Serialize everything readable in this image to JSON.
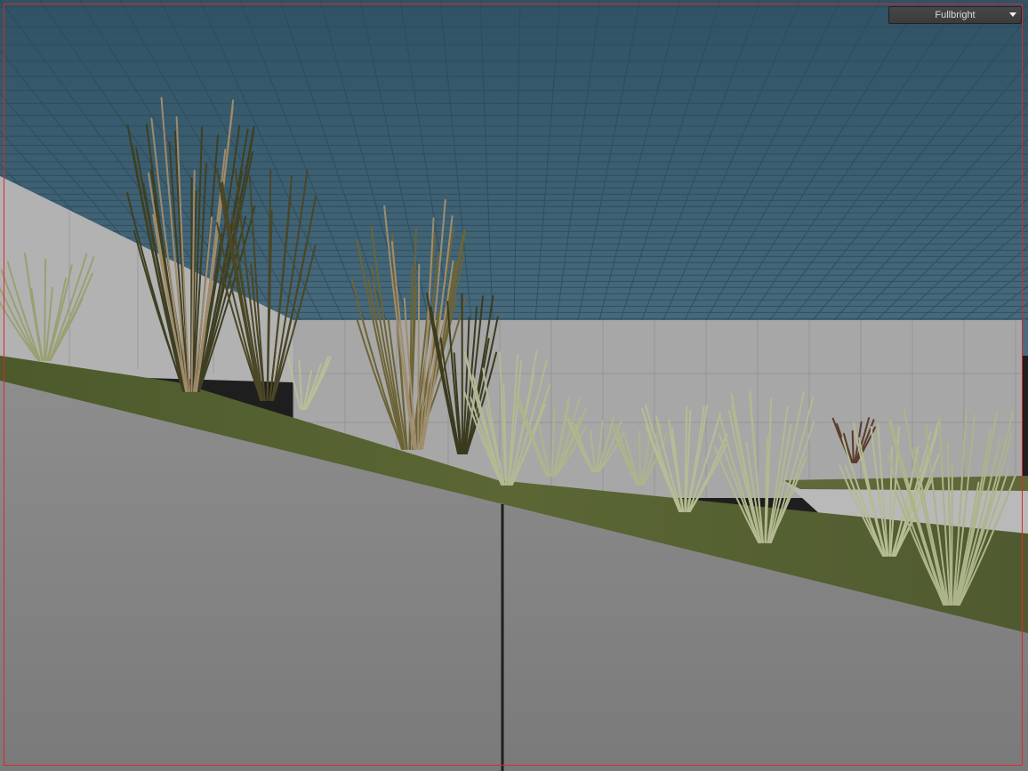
{
  "viewport": {
    "render_mode": "Fullbright",
    "render_mode_icon": "chevron-down-icon"
  },
  "colors": {
    "sky": "#3f6579",
    "grid_line": "#2e4b5c",
    "wall": "#a9a9a9",
    "slope_face": "#838383",
    "grass_ground": "#56622f",
    "frame_border": "#e0262a",
    "dry_grass": "#8a7a52",
    "green_grass": "#b7bd93"
  }
}
